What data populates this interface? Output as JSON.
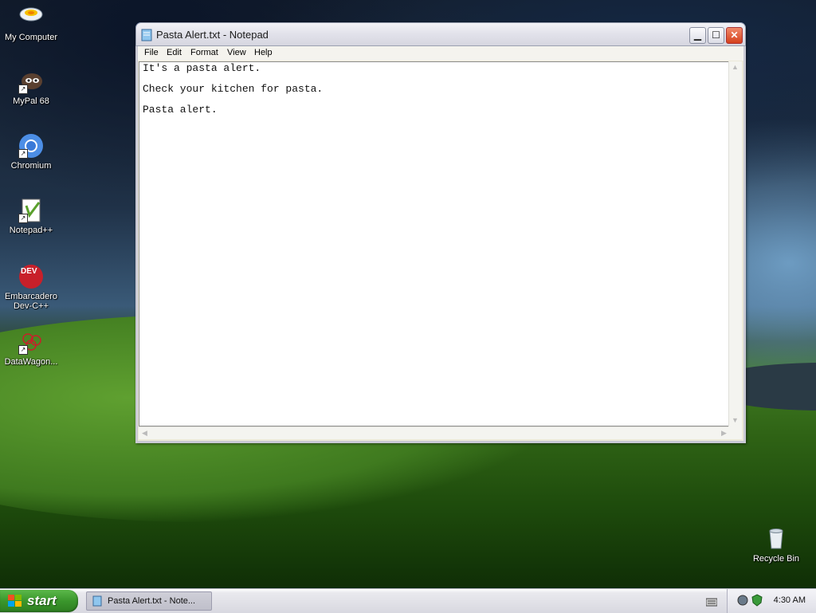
{
  "desktop": {
    "icons": [
      {
        "label": "My Computer",
        "icon": "my-computer-icon"
      },
      {
        "label": "MyPal 68",
        "icon": "mypal-icon"
      },
      {
        "label": "Chromium",
        "icon": "chromium-icon"
      },
      {
        "label": "Notepad++",
        "icon": "notepad-plus-plus-icon"
      },
      {
        "label_line1": "Embarcadero",
        "label_line2": "Dev-C++",
        "icon": "devcpp-icon",
        "badge": "DEV"
      },
      {
        "label": "DataWagon...",
        "icon": "datawagon-icon"
      },
      {
        "label": "Recycle Bin",
        "icon": "recycle-bin-icon"
      }
    ]
  },
  "window": {
    "title": "Pasta Alert.txt - Notepad",
    "menu": [
      "File",
      "Edit",
      "Format",
      "View",
      "Help"
    ],
    "lines": [
      "It's a pasta alert.",
      "Check your kitchen for pasta.",
      "Pasta alert."
    ]
  },
  "taskbar": {
    "start_label": "start",
    "task_label": "Pasta Alert.txt - Note...",
    "clock": "4:30 AM"
  },
  "colors": {
    "titlebar": "#e4e4ec",
    "start_green": "#3a962c",
    "close_red": "#d5401c"
  }
}
